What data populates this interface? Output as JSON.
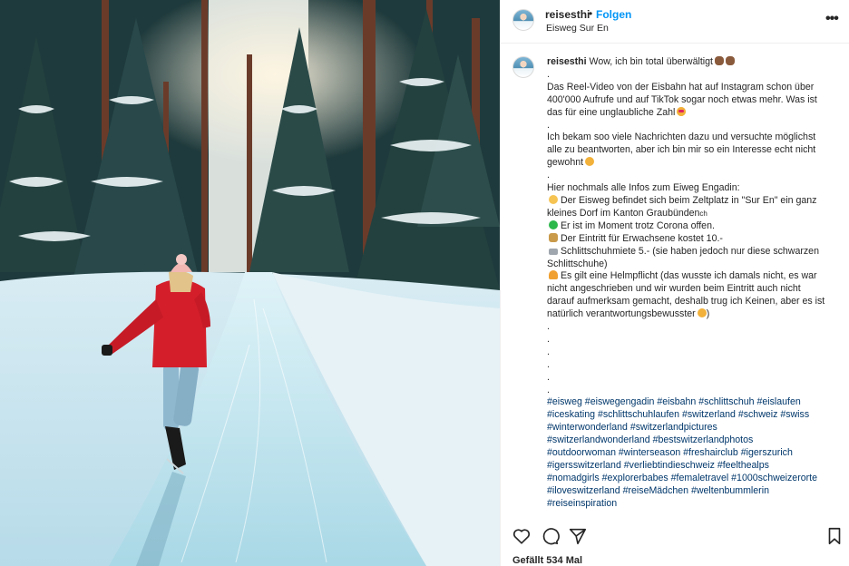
{
  "post": {
    "username": "reisesthi",
    "follow_label": "Folgen",
    "separator": "•",
    "location": "Eisweg Sur En",
    "more_label": "•••"
  },
  "caption": {
    "line1_text": "Wow, ich bin total überwältigt",
    "line_dot_1": ".",
    "p1": [
      "Das Reel-Video von der Eisbahn hat auf Instagram schon über",
      "400'000 Aufrufe und auf TikTok sogar noch etwas mehr. Was ist",
      "das für eine unglaubliche Zahl"
    ],
    "line_dot_2": ".",
    "p2": [
      "Ich bekam soo viele Nachrichten dazu und versuchte möglichst",
      "alle zu beantworten, aber ich bin mir so ein Interesse echt nicht",
      "gewohnt"
    ],
    "line_dot_3": ".",
    "info_title": "Hier nochmals alle Infos zum Eiweg Engadin:",
    "info": [
      "Der Eisweg befindet sich beim Zeltplatz in \"Sur En\" ein ganz",
      "kleines Dorf im Kanton Graubünden",
      "Er ist im Moment trotz Corona offen.",
      "Der Eintritt für Erwachsene kostet 10.-",
      "Schlittschuhmiete 5.- (sie haben jedoch nur diese schwarzen",
      "Schlittschuhe)",
      "Es gilt eine Helmpflicht (das wusste ich damals nicht, es war",
      "nicht angeschrieben und wir wurden beim Eintritt auch nicht",
      "darauf aufmerksam gemacht, deshalb trug ich Keinen, aber es ist",
      "natürlich verantwortungsbewusster"
    ],
    "info_suffix_paren": ")",
    "ch_flag": "ch",
    "dots": [
      ".",
      ".",
      ".",
      ".",
      ".",
      "."
    ],
    "hashtags": [
      "#eisweg #eiswegengadin #eisbahn #schlittschuh #eislaufen",
      "#iceskating #schlittschuhlaufen #switzerland #schweiz #swiss",
      "#winterwonderland #switzerlandpictures",
      "#switzerlandwonderland #bestswitzerlandphotos",
      "#outdoorwoman #winterseason #freshairclub #igerszurich",
      "#igersswitzerland #verliebtindieschweiz #feelthealps",
      "#nomadgirls #explorerbabes #femaletravel #1000schweizerorte",
      "#iloveswitzerland #reiseMädchen #weltenbummlerin",
      "#reiseinspiration"
    ]
  },
  "actions": {
    "like_icon": "heart-icon",
    "comment_icon": "comment-icon",
    "share_icon": "send-icon",
    "save_icon": "bookmark-icon"
  },
  "likes_text": "Gefällt 534 Mal",
  "colors": {
    "link_blue": "#0095f6",
    "hashtag_blue": "#00376b",
    "text": "#262626",
    "jacket_red": "#d41f2b"
  }
}
